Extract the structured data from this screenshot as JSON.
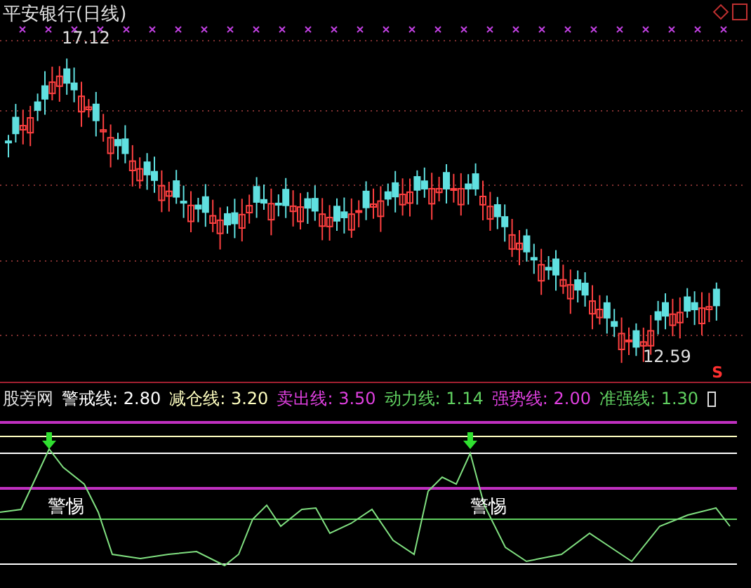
{
  "chart_title": "平安银行(日线)",
  "high_label": "17.12",
  "low_label": "12.59",
  "signal_marker": "S",
  "indicator": {
    "name": "股旁网",
    "legend": [
      {
        "label": "警戒线:",
        "value": "2.80",
        "color": "#ffffff"
      },
      {
        "label": "减仓线:",
        "value": "3.20",
        "color": "#ffffc0"
      },
      {
        "label": "卖出线:",
        "value": "3.50",
        "color": "#e040e0"
      },
      {
        "label": "动力线:",
        "value": "1.14",
        "color": "#60d060"
      },
      {
        "label": "强势线:",
        "value": "2.00",
        "color": "#e040e0"
      },
      {
        "label": "准强线:",
        "value": "1.30",
        "color": "#60d060"
      }
    ],
    "alerts": [
      "警惕",
      "警惕"
    ]
  }
}
